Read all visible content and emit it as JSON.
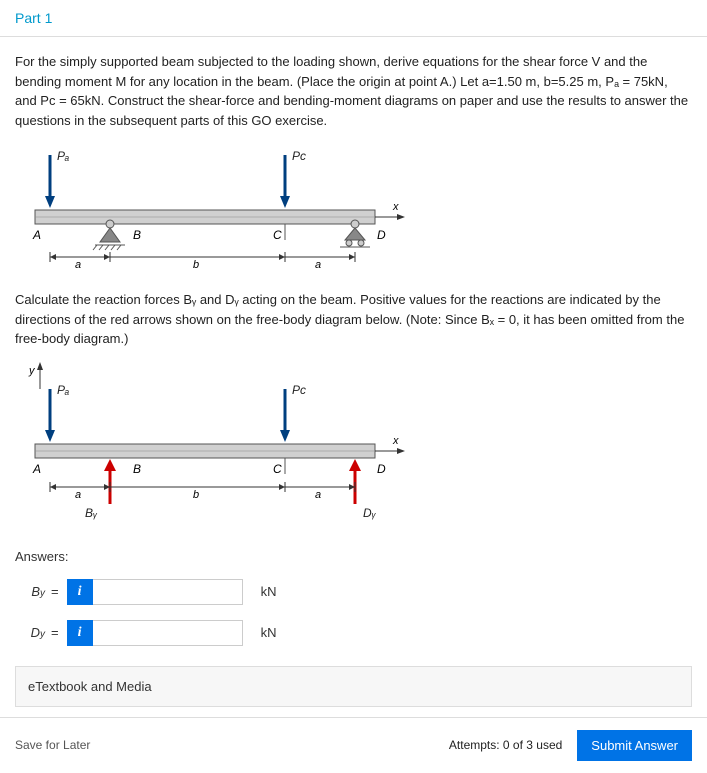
{
  "header": {
    "title": "Part 1"
  },
  "problem": {
    "text": "For the simply supported beam subjected to the loading shown, derive equations for the shear force V and the bending moment M for any location in the beam. (Place the origin at point A.) Let a=1.50 m, b=5.25 m, Pₐ = 75kN, and Pᴄ = 65kN. Construct the shear-force and bending-moment diagrams on paper and use the results to answer the questions in the subsequent parts of this GO exercise."
  },
  "diagram1": {
    "labels": {
      "PA": "Pₐ",
      "PC": "Pᴄ",
      "A": "A",
      "B": "B",
      "C": "C",
      "D": "D",
      "a": "a",
      "b": "b",
      "x": "x"
    }
  },
  "calc": {
    "text": "Calculate the reaction forces Bᵧ and Dᵧ acting on the beam. Positive values for the reactions are indicated by the directions of the red arrows shown on the free-body diagram below. (Note: Since Bₓ = 0, it has been omitted from the free-body diagram.)"
  },
  "diagram2": {
    "labels": {
      "y": "y",
      "PA": "Pₐ",
      "PC": "Pᴄ",
      "A": "A",
      "B": "B",
      "C": "C",
      "D": "D",
      "a": "a",
      "b": "b",
      "x": "x",
      "By": "Bᵧ",
      "Dy": "Dᵧ"
    }
  },
  "answers": {
    "heading": "Answers:",
    "rows": [
      {
        "var": "B",
        "sub": "y",
        "unit": "kN",
        "value": ""
      },
      {
        "var": "D",
        "sub": "y",
        "unit": "kN",
        "value": ""
      }
    ]
  },
  "etextbook": {
    "label": "eTextbook and Media"
  },
  "footer": {
    "save": "Save for Later",
    "attempts": "Attempts: 0 of 3 used",
    "submit": "Submit Answer"
  }
}
